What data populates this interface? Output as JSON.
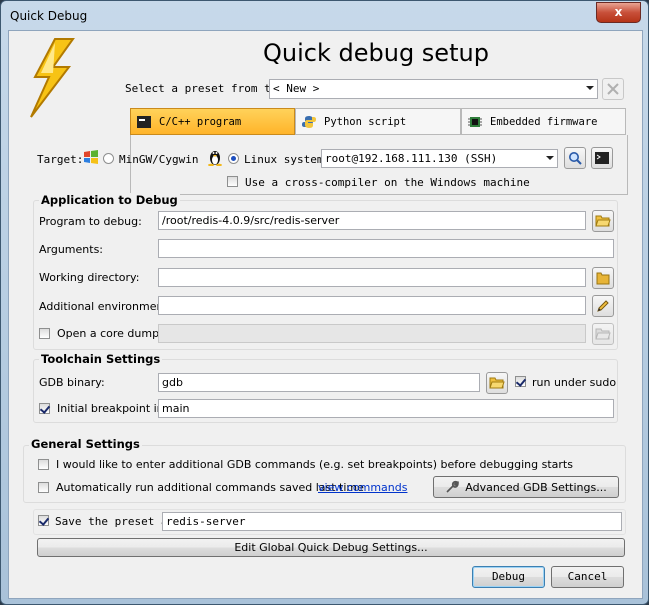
{
  "window": {
    "title": "Quick Debug",
    "close_glyph": "x"
  },
  "header": {
    "title": "Quick debug setup"
  },
  "preset": {
    "label": "Select a preset from the",
    "value": "< New >"
  },
  "tabs": [
    {
      "label": "C/C++ program",
      "icon": "cpp-terminal-icon",
      "active": true
    },
    {
      "label": "Python script",
      "icon": "python-icon",
      "active": false
    },
    {
      "label": "Embedded firmware",
      "icon": "chip-icon",
      "active": false
    }
  ],
  "target": {
    "label": "Target:",
    "mingw_label": "MinGW/Cygwin",
    "linux_label": "Linux system:",
    "linux_value": "root@192.168.111.130 (SSH)",
    "cross_compiler_label": "Use a cross-compiler on the Windows machine"
  },
  "app": {
    "title": "Application to Debug",
    "program_label": "Program to debug:",
    "program_value": "/root/redis-4.0.9/src/redis-server",
    "arguments_label": "Arguments:",
    "arguments_value": "",
    "workdir_label": "Working directory:",
    "workdir_value": "",
    "env_label": "Additional environment:",
    "env_value": "",
    "coredump_label": "Open a core dump:",
    "coredump_value": ""
  },
  "toolchain": {
    "title": "Toolchain Settings",
    "gdb_label": "GDB binary:",
    "gdb_value": "gdb",
    "sudo_label": "run under sudo",
    "bp_label": "Initial breakpoint in:",
    "bp_value": "main"
  },
  "general": {
    "title": "General Settings",
    "extra_cmds_label": "I would like to enter additional GDB commands (e.g. set breakpoints) before debugging starts",
    "auto_run_label": "Automatically run additional commands saved last time",
    "view_commands_link": "view commands",
    "advanced_button": "Advanced GDB Settings..."
  },
  "save_preset": {
    "label": "Save the preset as",
    "value": "redis-server"
  },
  "buttons": {
    "edit_global": "Edit Global Quick Debug Settings...",
    "debug": "Debug",
    "cancel": "Cancel"
  },
  "colors": {
    "tab_active": "#ffc03a",
    "link": "#0033cc"
  }
}
